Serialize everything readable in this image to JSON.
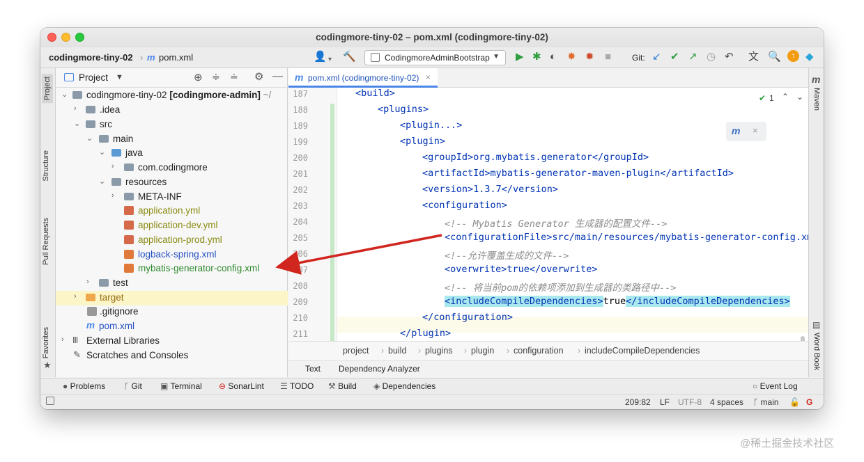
{
  "window": {
    "title": "codingmore-tiny-02 – pom.xml (codingmore-tiny-02)"
  },
  "navbar": {
    "project": "codingmore-tiny-02",
    "file": "pom.xml",
    "run_config": "CodingmoreAdminBootstrap",
    "git_label": "Git:"
  },
  "sidebar_left": {
    "tabs": [
      "Project",
      "Structure",
      "Pull Requests",
      "Favorites"
    ]
  },
  "sidebar_right": {
    "tabs": [
      "Maven",
      "Word Book"
    ]
  },
  "project_panel": {
    "title": "Project",
    "tree": [
      {
        "label": "codingmore-tiny-02",
        "bold_suffix": "[codingmore-admin]",
        "tail": "~/",
        "arrow": "⌄"
      },
      {
        "label": ".idea",
        "arrow": "›"
      },
      {
        "label": "src",
        "arrow": "⌄"
      },
      {
        "label": "main",
        "arrow": "⌄"
      },
      {
        "label": "java",
        "arrow": "⌄"
      },
      {
        "label": "com.codingmore",
        "arrow": "›"
      },
      {
        "label": "resources",
        "arrow": "⌄"
      },
      {
        "label": "META-INF",
        "arrow": "›"
      },
      {
        "label": "application.yml",
        "arrow": ""
      },
      {
        "label": "application-dev.yml",
        "arrow": ""
      },
      {
        "label": "application-prod.yml",
        "arrow": ""
      },
      {
        "label": "logback-spring.xml",
        "arrow": ""
      },
      {
        "label": "mybatis-generator-config.xml",
        "arrow": ""
      },
      {
        "label": "test",
        "arrow": "›"
      },
      {
        "label": "target",
        "arrow": "›"
      },
      {
        "label": ".gitignore",
        "arrow": ""
      },
      {
        "label": "pom.xml",
        "arrow": ""
      },
      {
        "label": "External Libraries",
        "arrow": "›"
      },
      {
        "label": "Scratches and Consoles",
        "arrow": ""
      }
    ]
  },
  "editor": {
    "tab": "pom.xml (codingmore-tiny-02)",
    "inspection_count": "1",
    "line_numbers": [
      "187",
      "188",
      "189",
      "199",
      "200",
      "201",
      "202",
      "203",
      "204",
      "205",
      "206",
      "207",
      "208",
      "209",
      "210",
      "211"
    ],
    "lines": {
      "l187": "<build>",
      "l188": "<plugins>",
      "l189": "<plugin...>",
      "l199": "<plugin>",
      "l200": "<groupId>org.mybatis.generator</groupId>",
      "l201": "<artifactId>mybatis-generator-maven-plugin</artifactId>",
      "l202": "<version>1.3.7</version>",
      "l203": "<configuration>",
      "l204": "<!-- Mybatis Generator 生成器的配置文件-->",
      "l205": "<configurationFile>src/main/resources/mybatis-generator-config.xm",
      "l206": "<!--允许覆盖生成的文件-->",
      "l207": "<overwrite>true</overwrite>",
      "l208": "<!-- 将当前pom的依赖项添加到生成器的类路径中-->",
      "l209a": "<includeCompileDependencies>",
      "l209b": "true",
      "l209c": "</includeCompileDependencies>",
      "l210": "</configuration>",
      "l211": "</plugin>"
    },
    "breadcrumbs": [
      "project",
      "build",
      "plugins",
      "plugin",
      "configuration",
      "includeCompileDependencies"
    ],
    "subtabs": [
      "Text",
      "Dependency Analyzer"
    ]
  },
  "bottom_toolbar": {
    "items": [
      "Problems",
      "Git",
      "Terminal",
      "SonarLint",
      "TODO",
      "Build",
      "Dependencies"
    ],
    "event_log": "Event Log"
  },
  "statusbar": {
    "position": "209:82",
    "line_sep": "LF",
    "encoding": "UTF-8",
    "indent": "4 spaces",
    "branch": "main"
  },
  "watermark": "@稀土掘金技术社区",
  "colors": {
    "accent": "#4a86e8",
    "arrow": "#d0261e",
    "tag": "#0033b3",
    "comment": "#8c8c8c",
    "highlight": "#a8e8ee"
  }
}
